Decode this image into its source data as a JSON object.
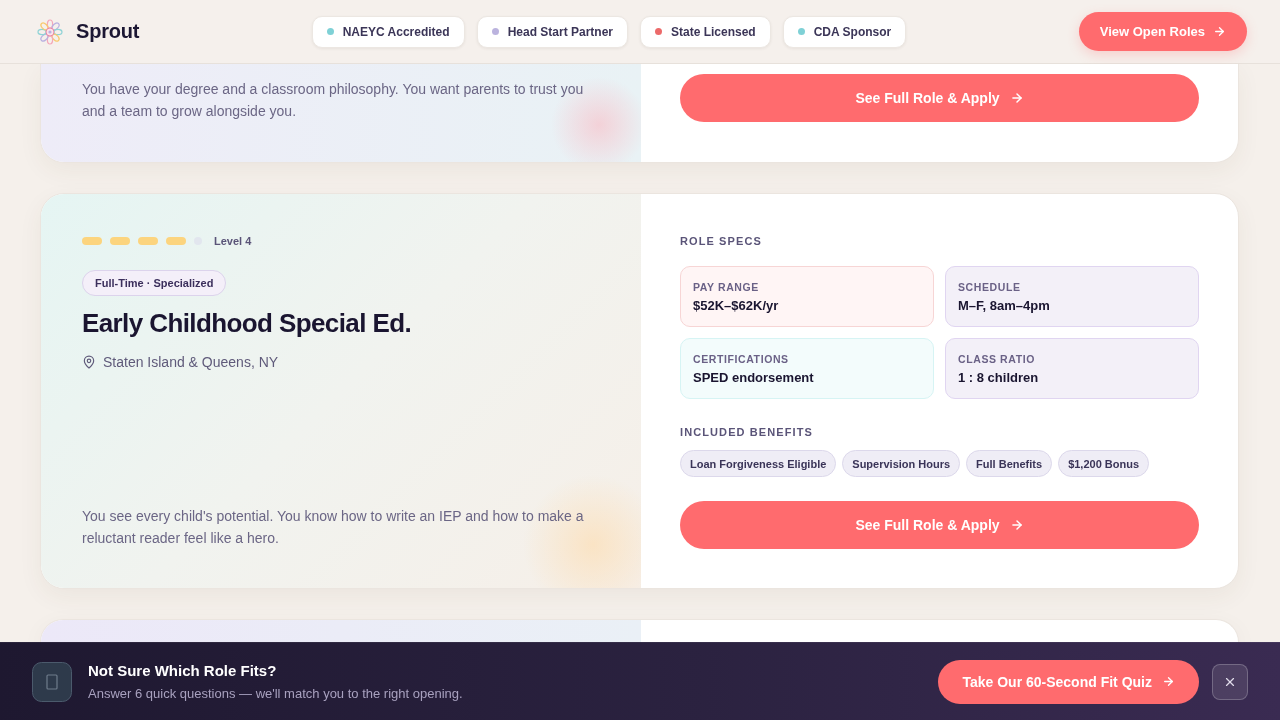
{
  "header": {
    "brand": "Sprout",
    "badges": [
      {
        "label": "NAEYC Accredited",
        "color": "#7fd1d6"
      },
      {
        "label": "Head Start Partner",
        "color": "#bbb3de"
      },
      {
        "label": "State Licensed",
        "color": "#ec6a6a"
      },
      {
        "label": "CDA Sponsor",
        "color": "#7fd1d6"
      }
    ],
    "cta": "View Open Roles"
  },
  "jobs": [
    {
      "description": "You have your degree and a classroom philosophy. You want parents to trust you and a team to grow alongside you.",
      "apply_button": "See Full Role & Apply"
    },
    {
      "stars": 4,
      "level_label": "Level 4",
      "tag": "Full-Time · Specialized",
      "title": "Early Childhood Special Ed.",
      "location": "Staten Island & Queens, NY",
      "description": "You see every child's potential. You know how to write an IEP and how to make a reluctant reader feel like a hero.",
      "specs_title": "ROLE SPECS",
      "specs": [
        {
          "label": "PAY RANGE",
          "value": "$52K–$62K/yr",
          "color": "#fff5f5"
        },
        {
          "label": "SCHEDULE",
          "value": "M–F, 8am–4pm",
          "color": "#f3f0f8"
        },
        {
          "label": "CERTIFICATIONS",
          "value": "SPED endorsement",
          "color": "#f3fcfc"
        },
        {
          "label": "CLASS RATIO",
          "value": "1 : 8 children",
          "color": "#f3f0f8"
        }
      ],
      "benefits_title": "INCLUDED BENEFITS",
      "benefits": [
        "Loan Forgiveness Eligible",
        "Supervision Hours",
        "Full Benefits",
        "$1,200 Bonus"
      ],
      "apply_button": "See Full Role & Apply"
    }
  ],
  "quiz_banner": {
    "title": "Not Sure Which Role Fits?",
    "subtitle": "Answer 6 quick questions — we'll match you to the right opening.",
    "button": "Take Our 60-Second Fit Quiz"
  }
}
